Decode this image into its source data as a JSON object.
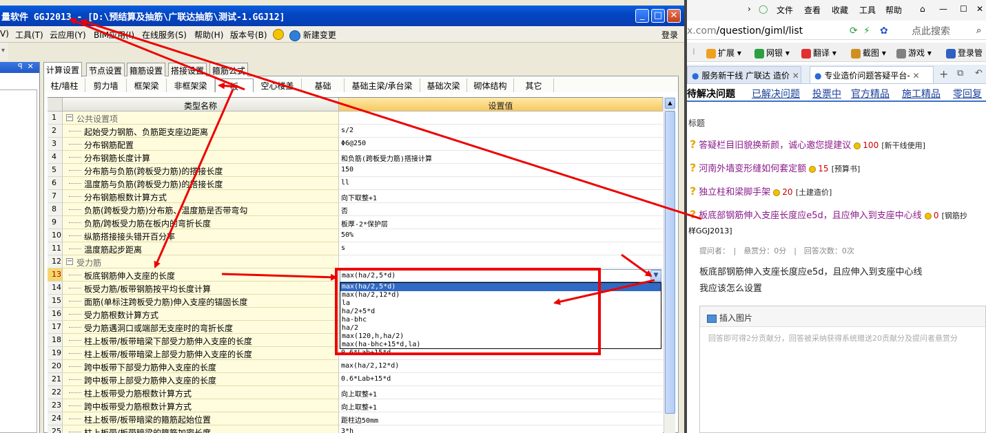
{
  "app": {
    "title": "量软件 GGJ2013 - [D:\\预结算及抽筋\\广联达抽筋\\测试-1.GGJ12]",
    "menu": [
      "V)",
      "工具(T)",
      "云应用(Y)",
      "BIM应用(I)",
      "在线服务(S)",
      "帮助(H)",
      "版本号(B)",
      "新建变更",
      "登录"
    ],
    "tabs": [
      "计算设置",
      "节点设置",
      "箍筋设置",
      "搭接设置",
      "箍筋公式"
    ],
    "subtabs": [
      "柱/墙柱",
      "剪力墙",
      "框架梁",
      "非框架梁",
      "板",
      "空心楼盖",
      "基础",
      "基础主梁/承台梁",
      "基础次梁",
      "砌体结构",
      "其它"
    ],
    "grid": {
      "header_name": "类型名称",
      "header_value": "设置值",
      "rows": [
        {
          "n": "1",
          "name": "公共设置项",
          "value": "",
          "group": true
        },
        {
          "n": "2",
          "name": "起始受力钢筋、负筋距支座边距离",
          "value": "s/2"
        },
        {
          "n": "3",
          "name": "分布钢筋配置",
          "value": "Φ6@250"
        },
        {
          "n": "4",
          "name": "分布钢筋长度计算",
          "value": "和负筋(跨板受力筋)搭接计算"
        },
        {
          "n": "5",
          "name": "分布筋与负筋(跨板受力筋)的搭接长度",
          "value": "150"
        },
        {
          "n": "6",
          "name": "温度筋与负筋(跨板受力筋)的搭接长度",
          "value": "ll"
        },
        {
          "n": "7",
          "name": "分布钢筋根数计算方式",
          "value": "向下取整+1"
        },
        {
          "n": "8",
          "name": "负筋(跨板受力筋)分布筋、温度筋是否带弯勾",
          "value": "否"
        },
        {
          "n": "9",
          "name": "负筋/跨板受力筋在板内的弯折长度",
          "value": "板厚-2*保护层"
        },
        {
          "n": "10",
          "name": "纵筋搭接接头错开百分率",
          "value": "50%"
        },
        {
          "n": "11",
          "name": "温度筋起步距离",
          "value": "s"
        },
        {
          "n": "12",
          "name": "受力筋",
          "value": "",
          "group": true
        },
        {
          "n": "13",
          "name": "板底钢筋伸入支座的长度",
          "value": "",
          "selected": true
        },
        {
          "n": "14",
          "name": "板受力筋/板带钢筋按平均长度计算",
          "value": ""
        },
        {
          "n": "15",
          "name": "面筋(单标注跨板受力筋)伸入支座的锚固长度",
          "value": ""
        },
        {
          "n": "16",
          "name": "受力筋根数计算方式",
          "value": ""
        },
        {
          "n": "17",
          "name": "受力筋遇洞口或端部无支座时的弯折长度",
          "value": ""
        },
        {
          "n": "18",
          "name": "柱上板带/板带暗梁下部受力筋伸入支座的长度",
          "value": ""
        },
        {
          "n": "19",
          "name": "柱上板带/板带暗梁上部受力筋伸入支座的长度",
          "value": "0.6*Lab+15*d"
        },
        {
          "n": "20",
          "name": "跨中板带下部受力筋伸入支座的长度",
          "value": "max(ha/2,12*d)"
        },
        {
          "n": "21",
          "name": "跨中板带上部受力筋伸入支座的长度",
          "value": "0.6*Lab+15*d"
        },
        {
          "n": "22",
          "name": "柱上板带受力筋根数计算方式",
          "value": "向上取整+1"
        },
        {
          "n": "23",
          "name": "跨中板带受力筋根数计算方式",
          "value": "向上取整+1"
        },
        {
          "n": "24",
          "name": "柱上板带/板带暗梁的箍筋起始位置",
          "value": "距柱边50mm"
        },
        {
          "n": "25",
          "name": "柱上板带/板带暗梁的箍筋加密长度",
          "value": "3*h"
        }
      ]
    },
    "combo_value": "max(ha/2,5*d)",
    "dropdown_options": [
      "max(ha/2,5*d)",
      "max(ha/2,12*d)",
      "la",
      "ha/2+5*d",
      "ha-bhc",
      "ha/2",
      "max(120,h,ha/2)",
      "max(ha-bhc+15*d,la)"
    ]
  },
  "browser": {
    "menu": [
      "文件",
      "查看",
      "收藏",
      "工具",
      "帮助"
    ],
    "url_prefix": "x.com",
    "url_path": "/question/giml/list",
    "search_placeholder": "点此搜索",
    "toolbar": [
      "扩展",
      "网银",
      "翻译",
      "截图",
      "游戏",
      "登录管"
    ],
    "tabs": [
      "服务新干线 广联达 造价",
      "专业造价问题答疑平台-"
    ],
    "nav": [
      "待解决问题",
      "已解决问题",
      "投票中",
      "官方精品",
      "施工精品",
      "零回复"
    ],
    "list_label": "标题",
    "questions": [
      {
        "title": "答疑栏目旧貌换新颜，诚心邀您提建议",
        "points": "100",
        "tag": "[新干线使用]"
      },
      {
        "title": "河南外墙变形缝如何套定额",
        "points": "15",
        "tag": "[预算书]"
      },
      {
        "title": "独立柱和梁脚手架",
        "points": "20",
        "tag": "[土建造价]"
      },
      {
        "title": "板底部钢筋伸入支座长度应e5d，且应伸入到支座中心线",
        "points": "0",
        "tag": "[钢筋抄"
      }
    ],
    "question_tail": "样GGJ2013]",
    "meta": "提问者：　|　悬赏分：0分　|　回答次数：0次",
    "question_title": "板底部钢筋伸入支座长度应e5d，且应伸入到支座中心线",
    "question_body": "我应该怎么设置",
    "insert_image": "插入图片",
    "answer_placeholder": "回答即可得2分贡献分，回答被采纳获得系统赠送20贡献分及提问者悬赏分"
  },
  "colors": {
    "title_bar": "#0446c4",
    "annotation": "#e00000",
    "header_value": "#f8c860",
    "highlight": "#316ac5"
  }
}
